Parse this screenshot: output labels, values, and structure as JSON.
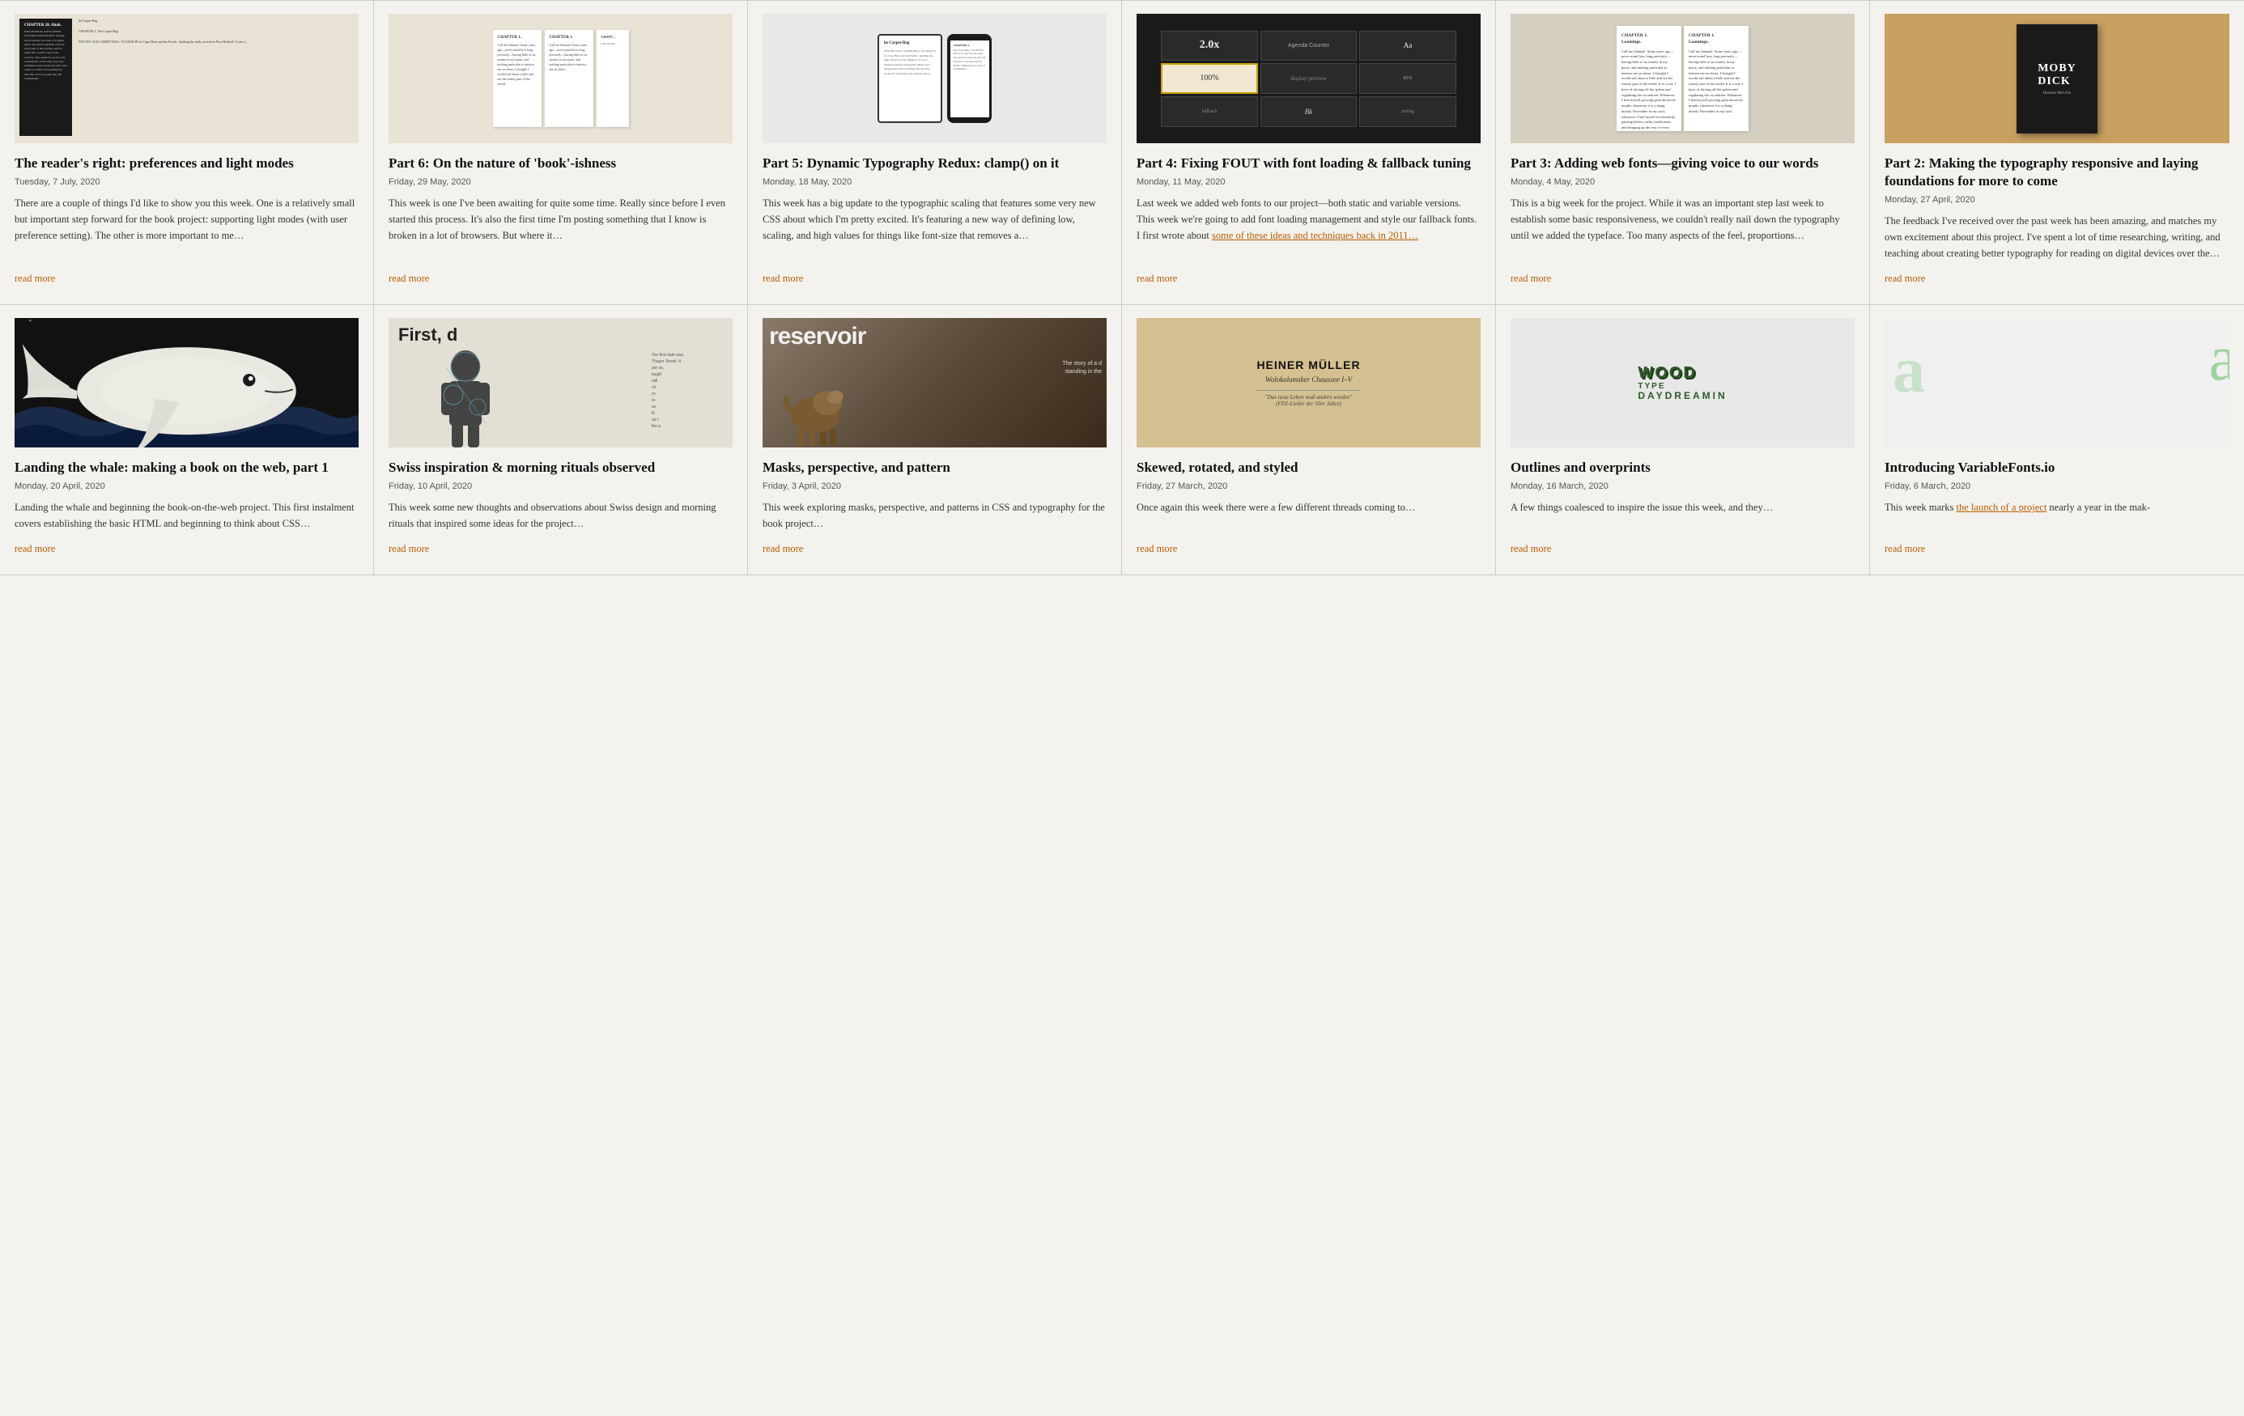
{
  "grid": {
    "rows": [
      {
        "cards": [
          {
            "id": "readers-right",
            "title": "The reader's right: preferences and light modes",
            "date": "Tuesday, 7 July, 2020",
            "excerpt": "There are a couple of things I'd like to show you this week. One is a relatively small but important step forward for the book project: supporting light modes (with user preference setting). The other is more important to me…",
            "read_more": "read more",
            "image_type": "readers"
          },
          {
            "id": "part6",
            "title": "Part 6: On the nature of 'book'-ishness",
            "date": "Friday, 29 May, 2020",
            "excerpt": "This week is one I've been awaiting for quite some time. Really since before I even started this process. It's also the first time I'm posting something that I know is broken in a lot of browsers. But where it…",
            "read_more": "read more",
            "image_type": "book-pages"
          },
          {
            "id": "part5",
            "title": "Part 5: Dynamic Typography Redux: clamp() on it",
            "date": "Monday, 18 May, 2020",
            "excerpt": "This week has a big update to the typographic scaling that features some very new CSS about which I'm pretty excited. It's featuring a new way of defining low, scaling, and high values for things like font-size that removes a…",
            "read_more": "read more",
            "image_type": "part5"
          },
          {
            "id": "part4",
            "title": "Part 4: Fixing FOUT with font loading & fallback tuning",
            "date": "Monday, 11 May, 2020",
            "excerpt": "Last week we added web fonts to our project—both static and variable versions. This week we're going to add font loading management and style our fallback fonts. I first wrote about",
            "link_text": "some of these ideas and techniques back in 2011…",
            "read_more": "read more",
            "image_type": "part4"
          },
          {
            "id": "part3",
            "title": "Part 3: Adding web fonts—giving voice to our words",
            "date": "Monday, 4 May, 2020",
            "excerpt": "This is a big week for the project. While it was an important step last week to establish some basic responsiveness, we couldn't really nail down the typography until we added the typeface. Too many aspects of the feel, proportions…",
            "read_more": "read more",
            "image_type": "part3"
          },
          {
            "id": "part2",
            "title": "Part 2: Making the typography responsive and laying foundations for more to come",
            "date": "Monday, 27 April, 2020",
            "excerpt": "The feedback I've received over the past week has been amazing, and matches my own excitement about this project. I've spent a lot of time researching, writing, and teaching about creating better typography for reading on digital devices over the…",
            "read_more": "read more",
            "image_type": "part2"
          }
        ]
      },
      {
        "cards": [
          {
            "id": "landing-whale",
            "title": "Landing the whale: making a book on the web, part 1",
            "date": "Monday, 20 April, 2020",
            "excerpt": "Landing the whale and beginning the book-on-the-web project. This first instalment covers…",
            "read_more": "read more",
            "image_type": "whale"
          },
          {
            "id": "swiss",
            "title": "Swiss inspiration & morning rituals observed",
            "date": "Friday, 10 April, 2020",
            "excerpt": "This week some new thoughts and observations about the project…",
            "read_more": "read more",
            "image_type": "swiss"
          },
          {
            "id": "masks",
            "title": "Masks, perspective, and pattern",
            "date": "Friday, 3 April, 2020",
            "excerpt": "This week exploring masks, perspective, and patterns in CSS and typography…",
            "read_more": "read more",
            "image_type": "reservoir"
          },
          {
            "id": "skewed",
            "title": "Skewed, rotated, and styled",
            "date": "Friday, 27 March, 2020",
            "excerpt": "Once again this week there were a few different threads coming to…",
            "read_more": "read more",
            "image_type": "heiner"
          },
          {
            "id": "outlines",
            "title": "Outlines and overprints",
            "date": "Monday, 16 March, 2020",
            "excerpt": "A few things coalesced to inspire the issue this week, and they…",
            "read_more": "read more",
            "image_type": "wood"
          },
          {
            "id": "variable-fonts",
            "title": "Introducing VariableFonts.io",
            "date": "Friday, 6 March, 2020",
            "excerpt": "This week marks",
            "link_text": "the launch of a project",
            "excerpt2": "nearly a year in the mak-",
            "read_more": "read more",
            "image_type": "variable"
          }
        ]
      }
    ]
  }
}
